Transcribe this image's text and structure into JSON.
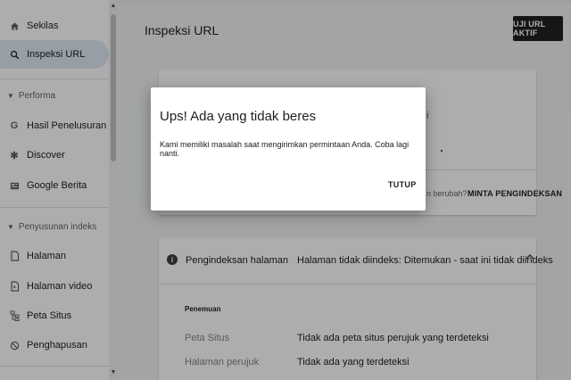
{
  "sidebar": {
    "items_top": [
      {
        "label": "Sekilas",
        "icon": "home-icon"
      },
      {
        "label": "Inspeksi URL",
        "icon": "search-icon",
        "active": true
      }
    ],
    "section_performa": "Performa",
    "items_performa": [
      {
        "label": "Hasil Penelusuran",
        "icon": "google-g-icon"
      },
      {
        "label": "Discover",
        "icon": "asterisk-icon"
      },
      {
        "label": "Google Berita",
        "icon": "news-icon"
      }
    ],
    "section_indeks": "Penyusunan indeks",
    "items_indeks": [
      {
        "label": "Halaman",
        "icon": "page-icon"
      },
      {
        "label": "Halaman video",
        "icon": "video-page-icon"
      },
      {
        "label": "Peta Situs",
        "icon": "sitemap-icon"
      },
      {
        "label": "Penghapusan",
        "icon": "removal-icon"
      }
    ]
  },
  "header": {
    "title": "Inspeksi URL",
    "live_test_button": "UJI URL AKTIF"
  },
  "card1": {
    "partial_question": "n berubah?",
    "request_indexing": "MINTA PENGINDEKSAN",
    "partial_letter": "i"
  },
  "indexing": {
    "label": "Pengindeksan halaman",
    "status": "Halaman tidak diindeks: Ditemukan - saat ini tidak diindeks",
    "discovery_heading": "Penemuan",
    "rows": [
      {
        "label": "Peta Situs",
        "value": "Tidak ada peta situs perujuk yang terdeteksi"
      },
      {
        "label": "Halaman perujuk",
        "value": "Tidak ada yang terdeteksi"
      }
    ]
  },
  "dialog": {
    "title": "Ups! Ada yang tidak beres",
    "message": "Kami memiliki masalah saat mengirimkan permintaan Anda. Coba lagi nanti.",
    "close_button": "TUTUP"
  }
}
